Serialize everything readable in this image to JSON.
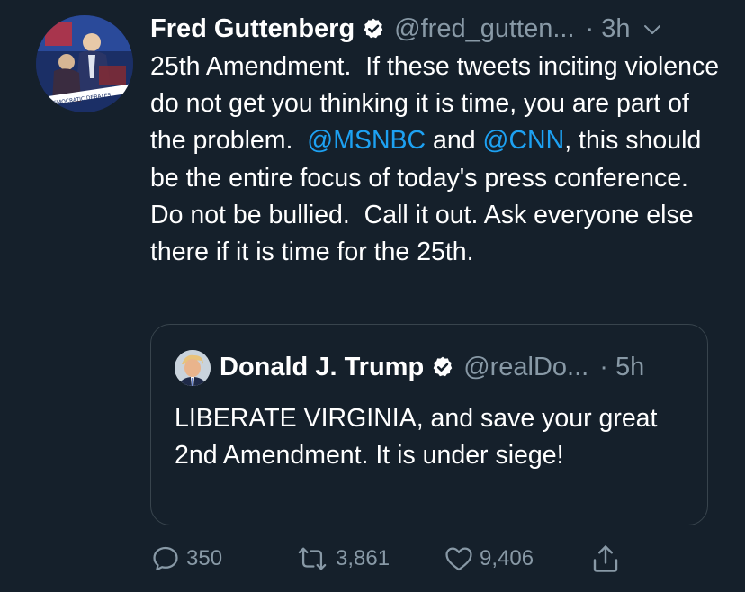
{
  "tweet": {
    "author_name": "Fred Guttenberg",
    "handle": "@fred_gutten...",
    "time": "· 3h",
    "avatar_caption": "DEMOCRATIC DEBATES",
    "text_parts": [
      "25th Amendment.  If these tweets inciting violence do not get you thinking it is time, you are part of the problem.  ",
      "@MSNBC",
      " and ",
      "@CNN",
      ", this should be the entire focus of today's press conference.  Do not be bullied.  Call it out. Ask everyone else there if it is time for the 25th."
    ]
  },
  "quoted": {
    "author_name": "Donald J. Trump",
    "handle": "@realDo...",
    "time": "· 5h",
    "text": "LIBERATE VIRGINIA, and save your great 2nd Amendment. It is under siege!"
  },
  "actions": {
    "replies": "350",
    "retweets": "3,861",
    "likes": "9,406"
  },
  "icons": {
    "verified": "verified-badge-icon",
    "more": "chevron-down-icon",
    "reply": "reply-icon",
    "retweet": "retweet-icon",
    "like": "heart-icon",
    "share": "share-icon"
  },
  "colors": {
    "background": "#15202b",
    "text": "#ffffff",
    "secondary": "#8899a6",
    "link": "#1da1f2",
    "border": "#38444d"
  }
}
